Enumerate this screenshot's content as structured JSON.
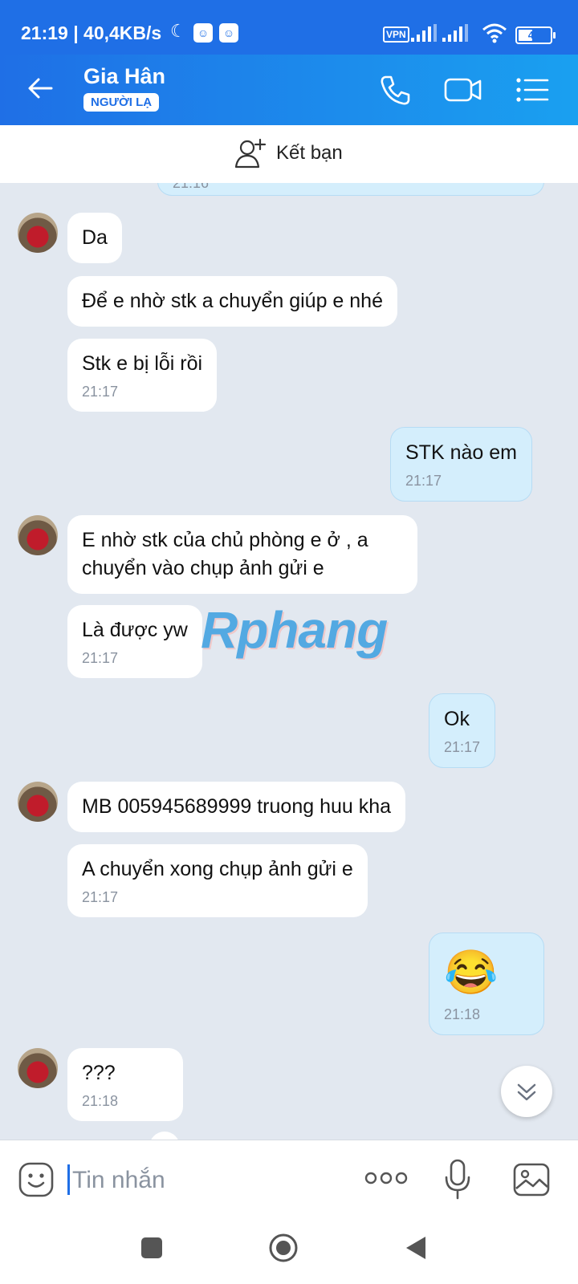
{
  "status_bar": {
    "time": "21:19",
    "network_speed": "40,4KB/s",
    "vpn_label": "VPN",
    "battery": "46",
    "icons": [
      "moon-icon",
      "app-notification-icon",
      "signal-icon",
      "wifi-icon",
      "battery-icon"
    ]
  },
  "header": {
    "contact_name": "Gia Hân",
    "badge": "NGƯỜI LẠ",
    "icons": [
      "back-arrow-icon",
      "phone-icon",
      "video-call-icon",
      "menu-icon"
    ]
  },
  "friend_bar": {
    "label": "Kết bạn"
  },
  "messages": [
    {
      "side": "out",
      "text": "",
      "time": "21:16"
    },
    {
      "side": "in",
      "text": "Da",
      "time": ""
    },
    {
      "side": "in",
      "text": "Để e nhờ stk a chuyển giúp e nhé",
      "time": ""
    },
    {
      "side": "in",
      "text": "Stk e bị lỗi rồi",
      "time": "21:17"
    },
    {
      "side": "out",
      "text": "STK nào em",
      "time": "21:17"
    },
    {
      "side": "in",
      "text": "E nhờ stk của chủ phòng e ở , a chuyển vào chụp ảnh gửi e",
      "time": ""
    },
    {
      "side": "in",
      "text": "Là được yw",
      "time": "21:17"
    },
    {
      "side": "out",
      "text": "Ok",
      "time": "21:17"
    },
    {
      "side": "in",
      "text": "MB 005945689999 truong huu kha",
      "time": ""
    },
    {
      "side": "in",
      "text": "A chuyển xong chụp ảnh gửi e",
      "time": "21:17"
    },
    {
      "side": "out",
      "text": "😂",
      "time": "21:18"
    },
    {
      "side": "in",
      "text": "???",
      "time": "21:18"
    }
  ],
  "watermark": "Rphang",
  "composer": {
    "placeholder": "Tin nhắn",
    "icons": [
      "sticker-icon",
      "more-icon",
      "microphone-icon",
      "image-icon"
    ]
  },
  "colors": {
    "header_start": "#1f6fe6",
    "header_end": "#1aa0f0",
    "chat_background": "#e2e8f0",
    "incoming_bubble": "#ffffff",
    "outgoing_bubble": "#d4eefc"
  }
}
